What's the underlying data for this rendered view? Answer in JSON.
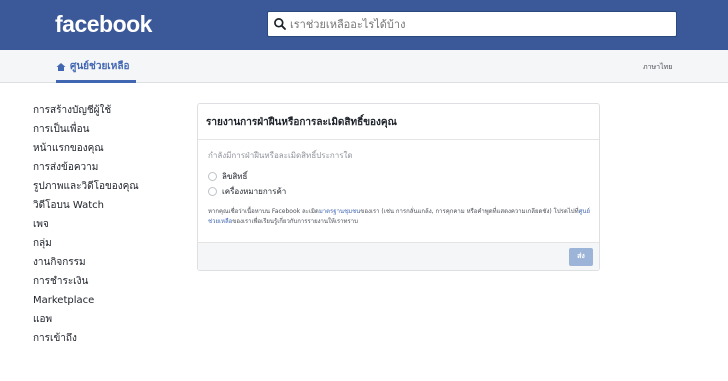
{
  "header": {
    "logo": "facebook",
    "search_placeholder": "เราช่วยเหลืออะไรได้บ้าง"
  },
  "subheader": {
    "help_center": "ศูนย์ช่วยเหลือ",
    "language": "ภาษาไทย"
  },
  "sidebar": {
    "items": [
      {
        "label": "การสร้างบัญชีผู้ใช้"
      },
      {
        "label": "การเป็นเพื่อน"
      },
      {
        "label": "หน้าแรกของคุณ"
      },
      {
        "label": "การส่งข้อความ"
      },
      {
        "label": "รูปภาพและวิดีโอของคุณ"
      },
      {
        "label": "วิดีโอบน Watch"
      },
      {
        "label": "เพจ"
      },
      {
        "label": "กลุ่ม"
      },
      {
        "label": "งานกิจกรรม"
      },
      {
        "label": "การชำระเงิน"
      },
      {
        "label": "Marketplace"
      },
      {
        "label": "แอพ"
      },
      {
        "label": "การเข้าถึง"
      }
    ]
  },
  "report": {
    "title": "รายงานการฝ่าฝืนหรือการละเมิดสิทธิ์ของคุณ",
    "question": "กำลังมีการฝ่าฝืนหรือละเมิดสิทธิ์ประการใด",
    "options": [
      {
        "label": "ลิขสิทธิ์"
      },
      {
        "label": "เครื่องหมายการค้า"
      }
    ],
    "note_pre": "หากคุณเชื่อว่าเนื้อหาบน Facebook ละเมิด",
    "note_link1": "มาตรฐานชุมชน",
    "note_mid": "ของเรา (เช่น การกลั่นแกล้ง, การคุกคาม หรือคำพูดที่แสดงความเกลียดชัง) โปรดไปที่",
    "note_link2": "ศูนย์ช่วยเหลือ",
    "note_post": "ของเราเพื่อเรียนรู้เกี่ยวกับการรายงานให้เราทราบ",
    "submit_label": "ส่ง"
  },
  "colors": {
    "brand": "#3b5998",
    "link": "#4267b2",
    "button_disabled": "#9cb4d8"
  }
}
